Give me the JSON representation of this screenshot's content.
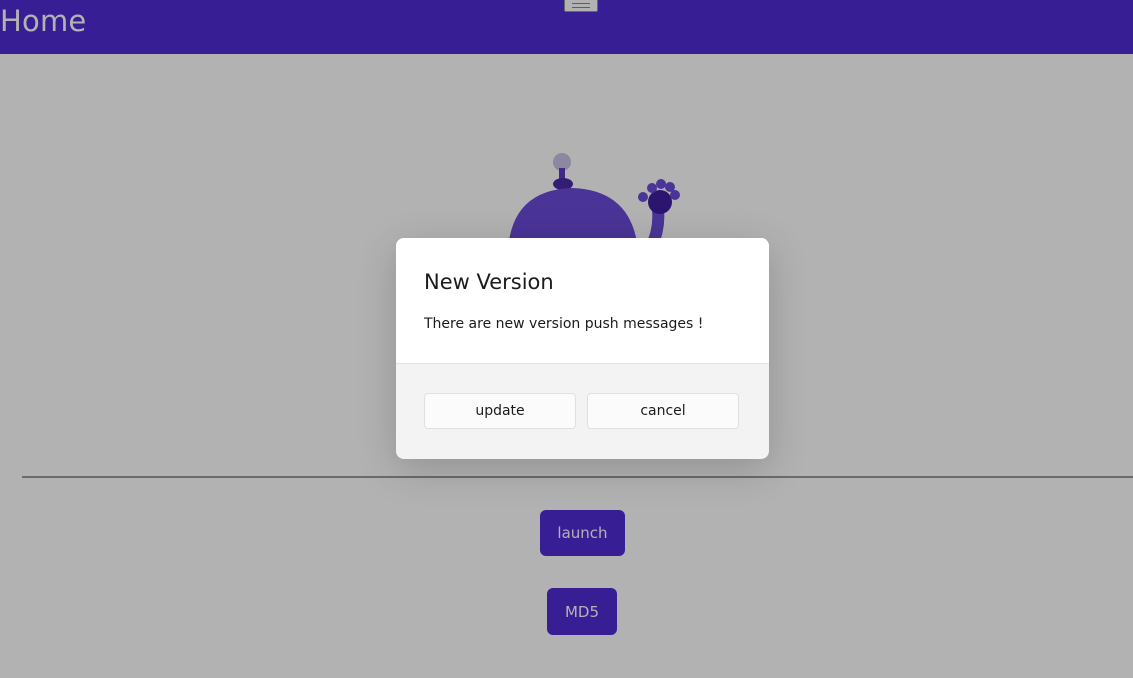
{
  "header": {
    "title": "Home"
  },
  "content": {
    "launch_label": "launch",
    "md5_label": "MD5"
  },
  "dialog": {
    "title": "New Version",
    "message": "There are new version push messages !",
    "update_label": "update",
    "cancel_label": "cancel"
  },
  "colors": {
    "accent": "#512bd4",
    "overlay": "rgba(0,0,0,0.30)"
  },
  "icons": {
    "menu": "menu-icon",
    "mascot": "dotnet-bot-icon"
  }
}
